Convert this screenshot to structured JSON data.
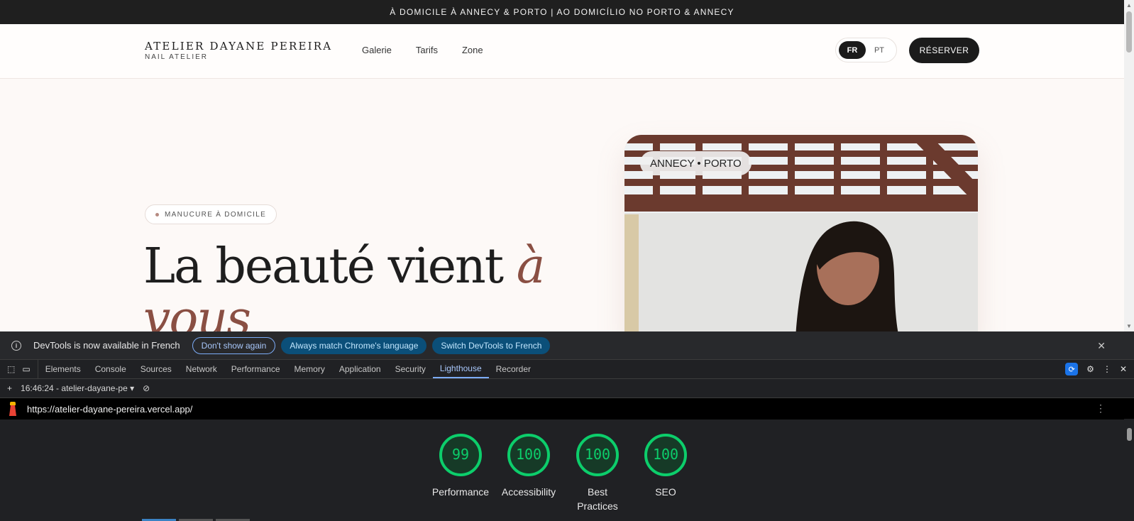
{
  "site": {
    "announcement": "À DOMICILE À ANNECY & PORTO | AO DOMICÍLIO NO PORTO & ANNECY",
    "brand_name": "ATELIER DAYANE PEREIRA",
    "brand_sub": "NAIL ATELIER",
    "nav": [
      "Galerie",
      "Tarifs",
      "Zone"
    ],
    "lang_fr": "FR",
    "lang_pt": "PT",
    "reserve": "RÉSERVER",
    "pill": "MANUCURE À DOMICILE",
    "headline_main": "La beauté vient ",
    "headline_accent": "à vous",
    "photo_label": "ANNECY • PORTO"
  },
  "devtools": {
    "info_text": "DevTools is now available in French",
    "btn_dont_show": "Don't show again",
    "btn_match": "Always match Chrome's language",
    "btn_switch": "Switch DevTools to French",
    "tabs": [
      "Elements",
      "Console",
      "Sources",
      "Network",
      "Performance",
      "Memory",
      "Application",
      "Security",
      "Lighthouse",
      "Recorder"
    ],
    "active_tab": "Lighthouse",
    "report_time": "16:46:24 - atelier-dayane-pe",
    "url": "https://atelier-dayane-pereira.vercel.app/",
    "scores": [
      {
        "value": 99,
        "label": "Performance"
      },
      {
        "value": 100,
        "label": "Accessibility"
      },
      {
        "value": 100,
        "label": "Best Practices"
      },
      {
        "value": 100,
        "label": "SEO"
      }
    ],
    "score_color": "#0cce6b"
  }
}
